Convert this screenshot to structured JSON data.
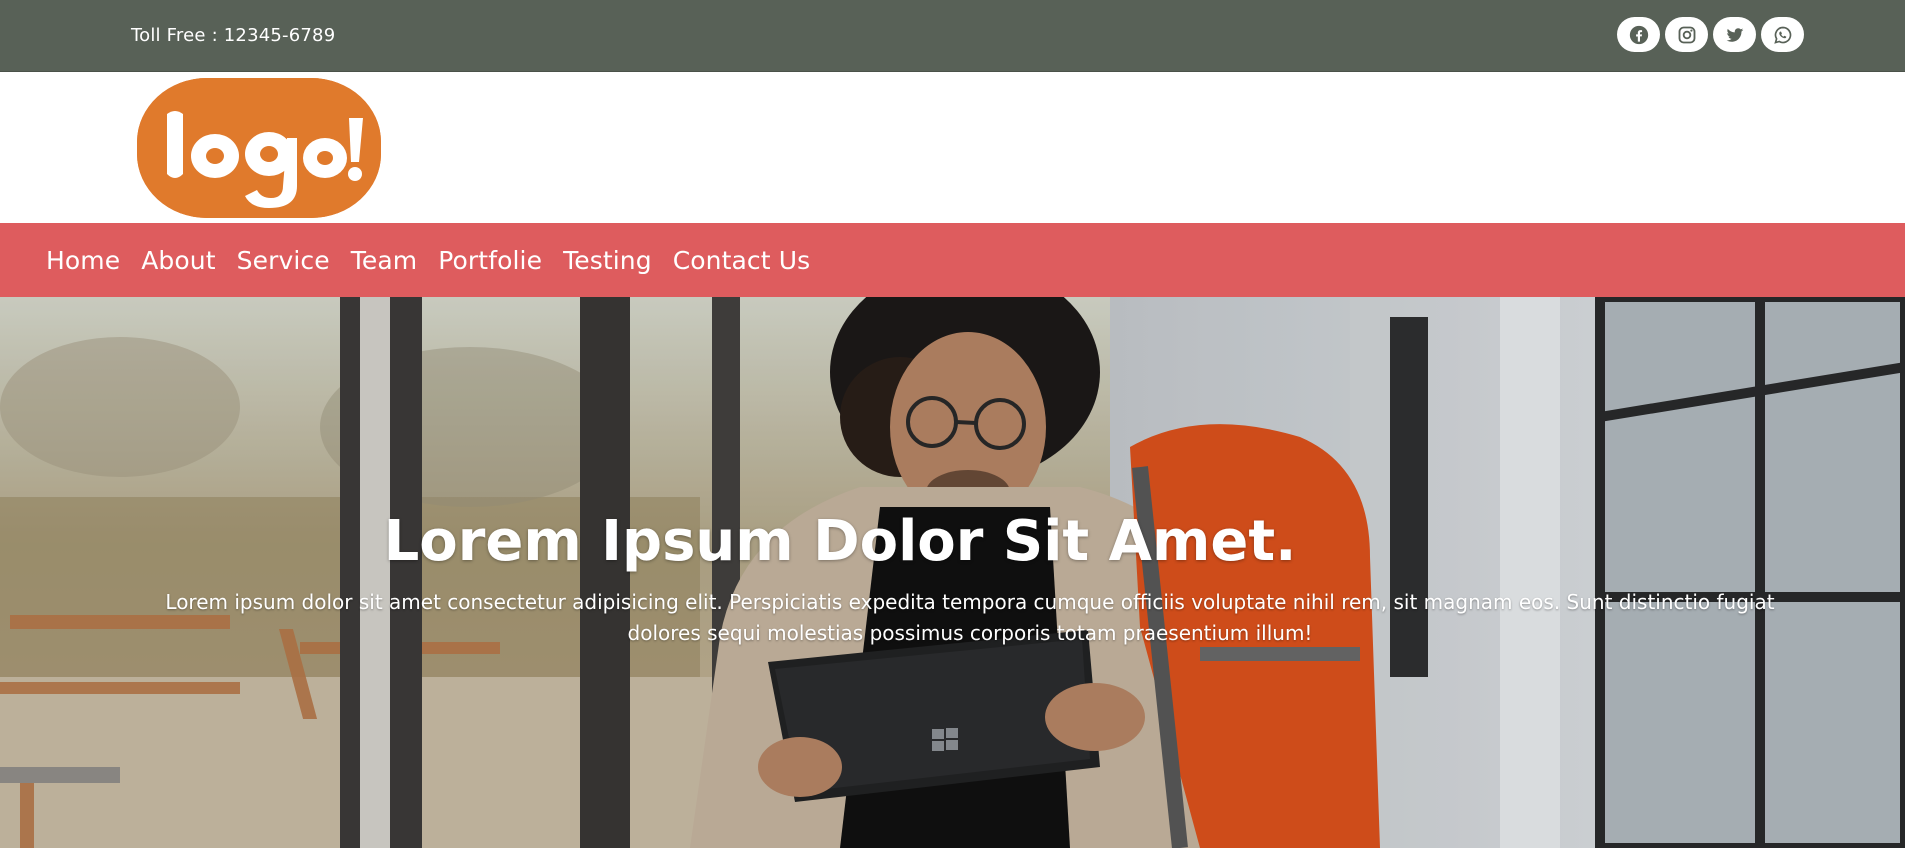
{
  "topbar": {
    "toll_free": "Toll Free : 12345-6789",
    "socials": [
      {
        "name": "facebook-icon"
      },
      {
        "name": "instagram-icon"
      },
      {
        "name": "twitter-icon"
      },
      {
        "name": "whatsapp-icon"
      }
    ],
    "bg_color": "#586157"
  },
  "logo": {
    "text": "logo!",
    "color": "#e07a2c"
  },
  "nav": {
    "bg_color": "#de5c5e",
    "items": [
      {
        "label": "Home"
      },
      {
        "label": "About"
      },
      {
        "label": "Service"
      },
      {
        "label": "Team"
      },
      {
        "label": "Portfolie"
      },
      {
        "label": "Testing"
      },
      {
        "label": "Contact Us"
      }
    ]
  },
  "hero": {
    "title": "Lorem Ipsum Dolor Sit Amet.",
    "text": "Lorem ipsum dolor sit amet consectetur adipisicing elit. Perspiciatis expedita tempora cumque officiis voluptate nihil rem, sit magnam eos. Sunt distinctio fugiat dolores sequi molestias possimus corporis totam praesentium illum!",
    "image": "person-with-backpack-holding-tablet-photo"
  }
}
